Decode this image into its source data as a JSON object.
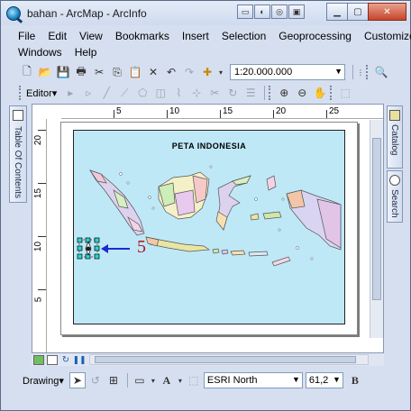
{
  "window": {
    "title": "bahan - ArcMap - ArcInfo"
  },
  "menu": {
    "row1": [
      "File",
      "Edit",
      "View",
      "Bookmarks",
      "Insert",
      "Selection",
      "Geoprocessing",
      "Customize"
    ],
    "row2": [
      "Windows",
      "Help"
    ]
  },
  "toolbar": {
    "scale": "1:20.000.000",
    "editor_label": "Editor"
  },
  "side_tabs": {
    "left": "Table Of Contents",
    "right_top": "Catalog",
    "right_bottom": "Search"
  },
  "rulers": {
    "top": [
      "5",
      "10",
      "15",
      "20",
      "25"
    ],
    "left": [
      "20",
      "15",
      "10",
      "5"
    ]
  },
  "map": {
    "title": "PETA INDONESIA",
    "callout": "5"
  },
  "drawing": {
    "label": "Drawing",
    "font": "ESRI North",
    "size": "61,2",
    "bold": "B"
  },
  "colors": {
    "sea": "#bfe8f7",
    "callout": "#b01020",
    "arrow": "#1b2bd0"
  }
}
